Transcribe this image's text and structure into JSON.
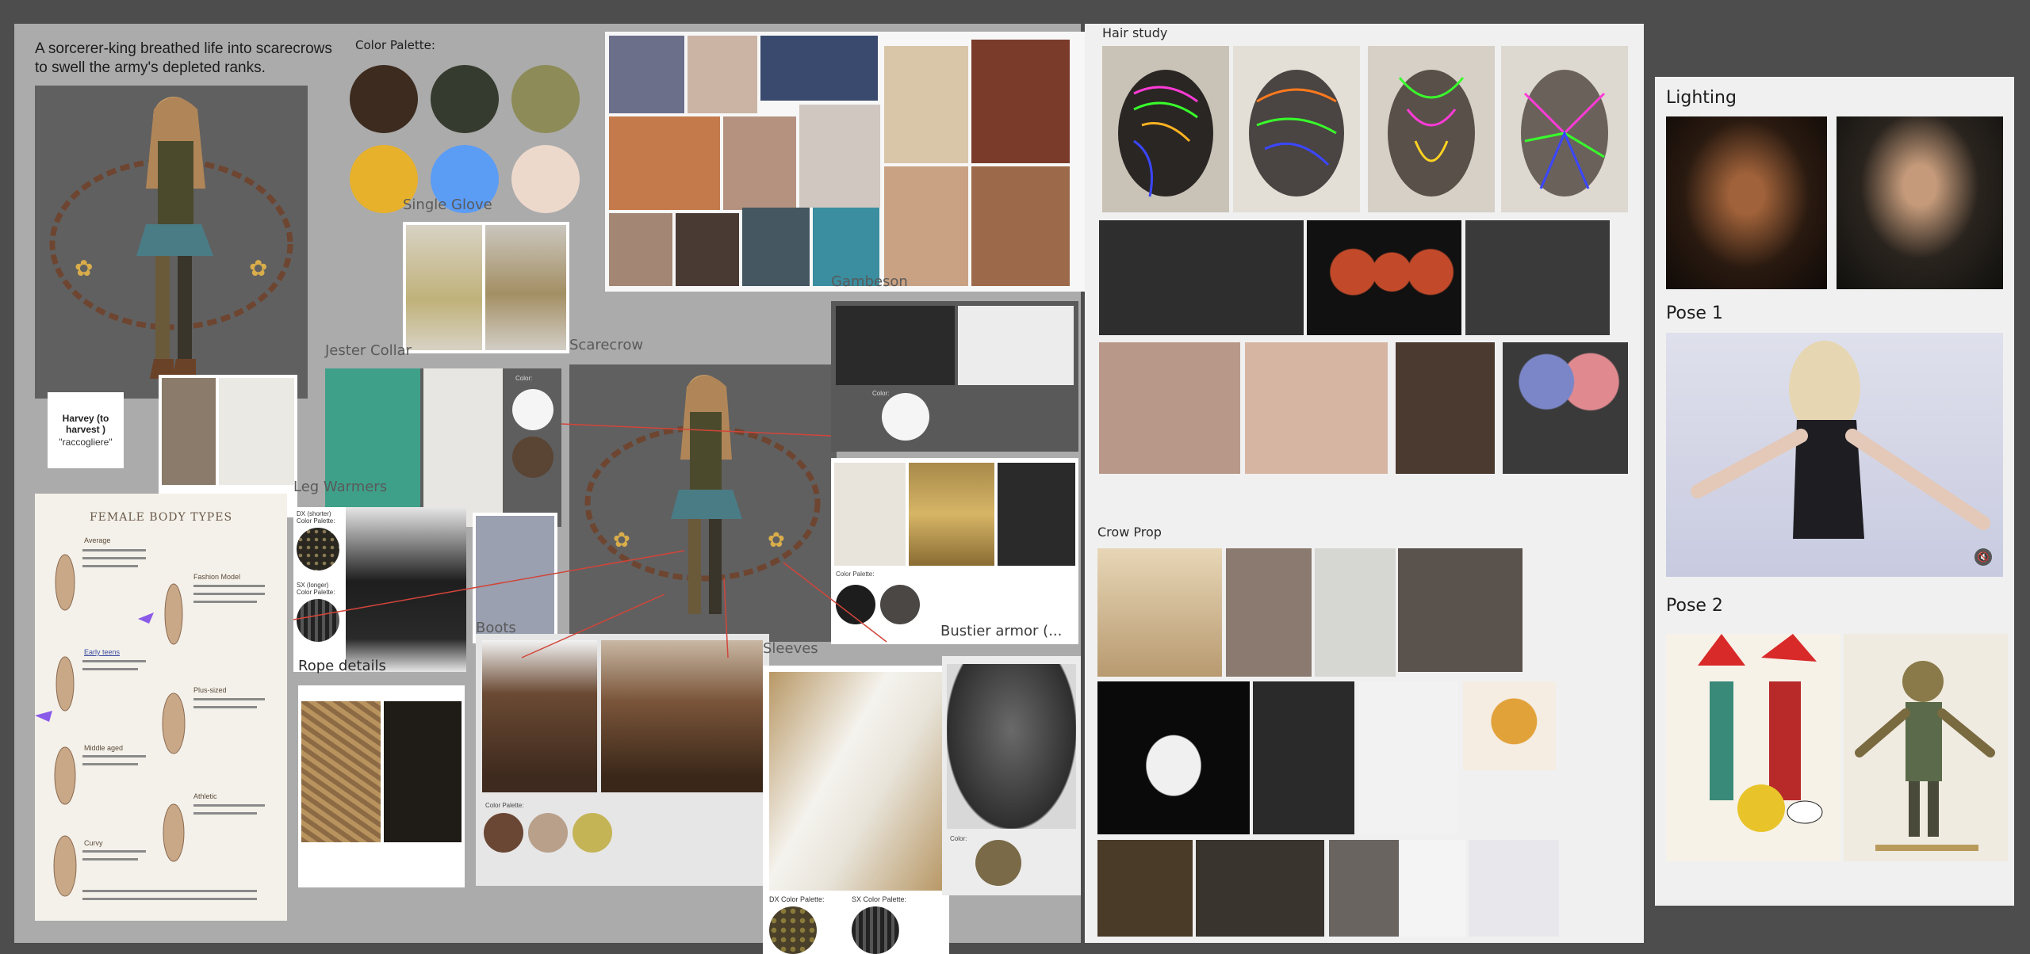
{
  "colors": {
    "canvas_bg": "#4d4d4d",
    "board_left": "#ababab",
    "board_mid": "#f0f0f0",
    "board_right": "#f0f0f0",
    "palette": [
      "#3d2b1f",
      "#353b2e",
      "#8d8b57",
      "#e8b12b",
      "#5b9cf5",
      "#edd9cc"
    ]
  },
  "story": {
    "line1": "A sorcerer-king breathed life into scarecrows",
    "line2": "to swell the army's depleted ranks."
  },
  "labels": {
    "color_palette": "Color Palette:",
    "single_glove": "Single Glove",
    "jester_collar": "Jester Collar",
    "scarecrow": "Scarecrow",
    "gambeson": "Gambeson",
    "leg_warmers": "Leg Warmers",
    "rope_details": "Rope details",
    "boots": "Boots",
    "sleeves": "Sleeves",
    "bustier_armor": "Bustier armor (...",
    "hair_study": "Hair study",
    "crow_prop": "Crow Prop",
    "lighting": "Lighting",
    "pose1": "Pose 1",
    "pose2": "Pose 2"
  },
  "name_card": {
    "title": "Harvey (to harvest )",
    "translation": "\"raccogliere\""
  },
  "small_text": {
    "jester_color": "Color:",
    "gambeson_color": "Color:",
    "dx_shorter": "DX (shorter)",
    "leg_palette": "Color Palette:",
    "sx_longer": "SX (longer)",
    "bustier_palette": "Color Palette:",
    "boots_palette": "Color Palette:",
    "sleeves_dx": "DX Color Palette:",
    "sleeves_sx": "SX Color Palette:",
    "corset_color": "Color:"
  },
  "body_types_doc": {
    "title": "FEMALE BODY TYPES",
    "types": [
      "Average",
      "Fashion Model",
      "Early teens",
      "Plus-sized",
      "Middle aged",
      "Athletic",
      "Curvy"
    ]
  }
}
